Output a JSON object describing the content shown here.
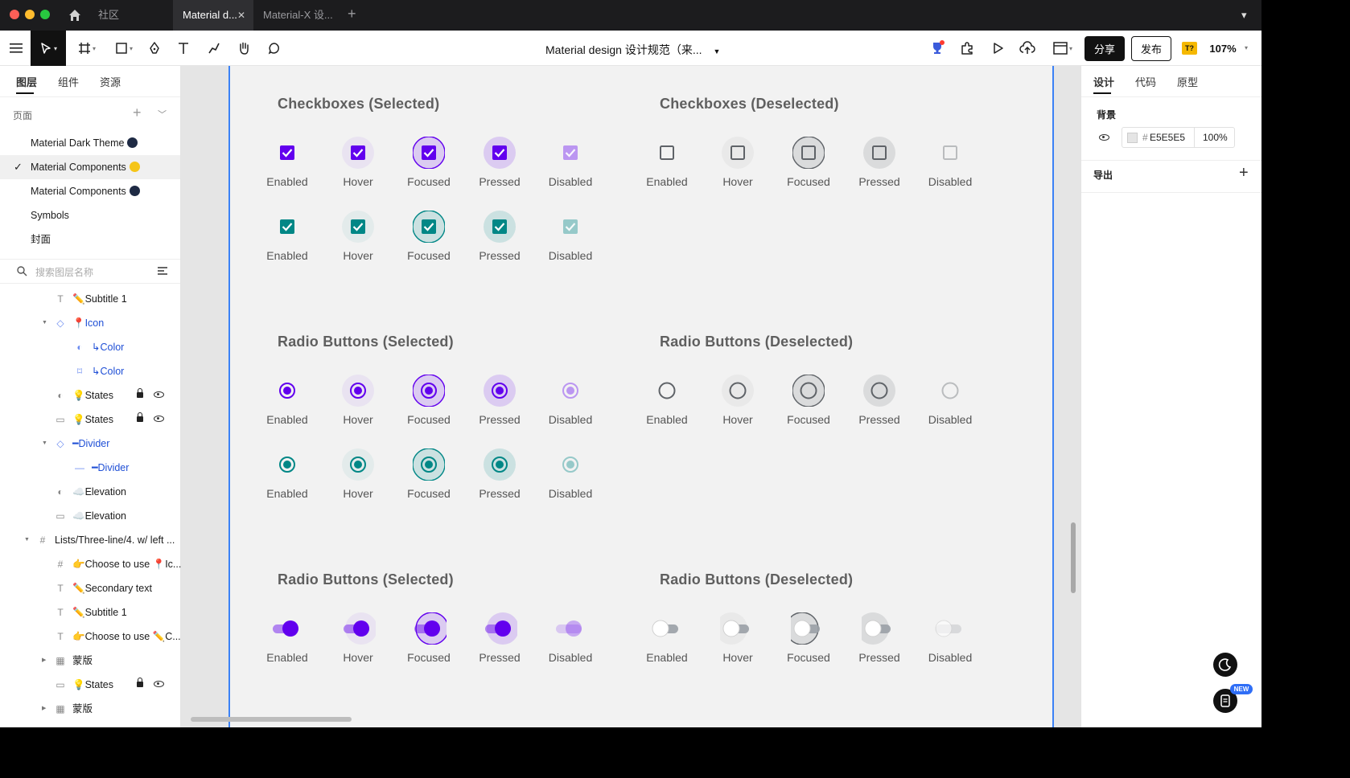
{
  "titlebar": {
    "tabs": [
      {
        "label": "社区"
      },
      {
        "label": "Material d...",
        "active": true
      },
      {
        "label": "Material-X 设..."
      }
    ],
    "add_tab": "+",
    "menu": "▾"
  },
  "toolbar": {
    "document_title": "Material design 设计规范（来...",
    "share_label": "分享",
    "publish_label": "发布",
    "plugin_badge": "T?",
    "zoom": "107%"
  },
  "left_panel": {
    "tabs": [
      "图层",
      "组件",
      "资源"
    ],
    "pages_label": "页面",
    "pages": [
      {
        "name": "Material Dark Theme",
        "dot_color": "#1e2a44",
        "selected": false
      },
      {
        "name": "Material Components",
        "dot_color": "#f5c518",
        "selected": true
      },
      {
        "name": "Material Components",
        "dot_color": "#1e2a44",
        "selected": false
      },
      {
        "name": "Symbols",
        "selected": false
      },
      {
        "name": "封面",
        "selected": false
      }
    ],
    "search_placeholder": "搜索图层名称",
    "layers": [
      {
        "label": "✏️Subtitle 1",
        "icon": "text-icon"
      },
      {
        "label": "📍Icon",
        "icon": "component-icon",
        "blue": true
      },
      {
        "label": "↳Color",
        "icon": "mask-icon",
        "blue": true
      },
      {
        "label": "↳Color",
        "icon": "bookmark-icon",
        "blue": true
      },
      {
        "label": "💡States",
        "icon": "mask-icon",
        "locked": true,
        "visible": true
      },
      {
        "label": "💡States",
        "icon": "rect-icon",
        "locked": true,
        "visible": true
      },
      {
        "label": "━Divider",
        "icon": "component-icon",
        "blue": true
      },
      {
        "label": "━Divider",
        "icon": "line-icon",
        "blue": true
      },
      {
        "label": "☁️Elevation",
        "icon": "mask-icon"
      },
      {
        "label": "☁️Elevation",
        "icon": "rect-icon"
      },
      {
        "label": "Lists/Three-line/4. w/ left ...",
        "icon": "frame-icon"
      },
      {
        "label": "👉Choose to use 📍Ic...",
        "icon": "frame-icon"
      },
      {
        "label": "✏️Secondary text",
        "icon": "text-icon"
      },
      {
        "label": "✏️Subtitle 1",
        "icon": "text-icon"
      },
      {
        "label": "👉Choose to use ✏️C...",
        "icon": "text-icon"
      },
      {
        "label": "蒙版",
        "icon": "mask-group-icon"
      },
      {
        "label": "💡States",
        "icon": "rect-icon",
        "locked": true,
        "visible": true
      },
      {
        "label": "蒙版",
        "icon": "mask-group-icon"
      }
    ]
  },
  "canvas": {
    "sections": [
      {
        "title": "Checkboxes (Selected)",
        "type": "checkbox-on"
      },
      {
        "title": "Checkboxes (Deselected)",
        "type": "checkbox-off"
      },
      {
        "title": "Radio Buttons (Selected)",
        "type": "radio-on"
      },
      {
        "title": "Radio Buttons (Deselected)",
        "type": "radio-off"
      },
      {
        "title": "Radio Buttons (Selected)",
        "type": "switch-on"
      },
      {
        "title": "Radio Buttons (Deselected)",
        "type": "switch-off"
      }
    ],
    "states": [
      "Enabled",
      "Hover",
      "Focused",
      "Pressed",
      "Disabled"
    ],
    "colors": {
      "primary": "#6200ee",
      "secondary": "#018786",
      "deselected": "#5f6368",
      "frame_bg": "#f2f2f2"
    }
  },
  "right_panel": {
    "tabs": [
      "设计",
      "代码",
      "原型"
    ],
    "background_label": "背景",
    "hex_prefix": "#",
    "color_value": "E5E5E5",
    "opacity": "100%",
    "export_label": "导出",
    "new_badge": "NEW"
  }
}
